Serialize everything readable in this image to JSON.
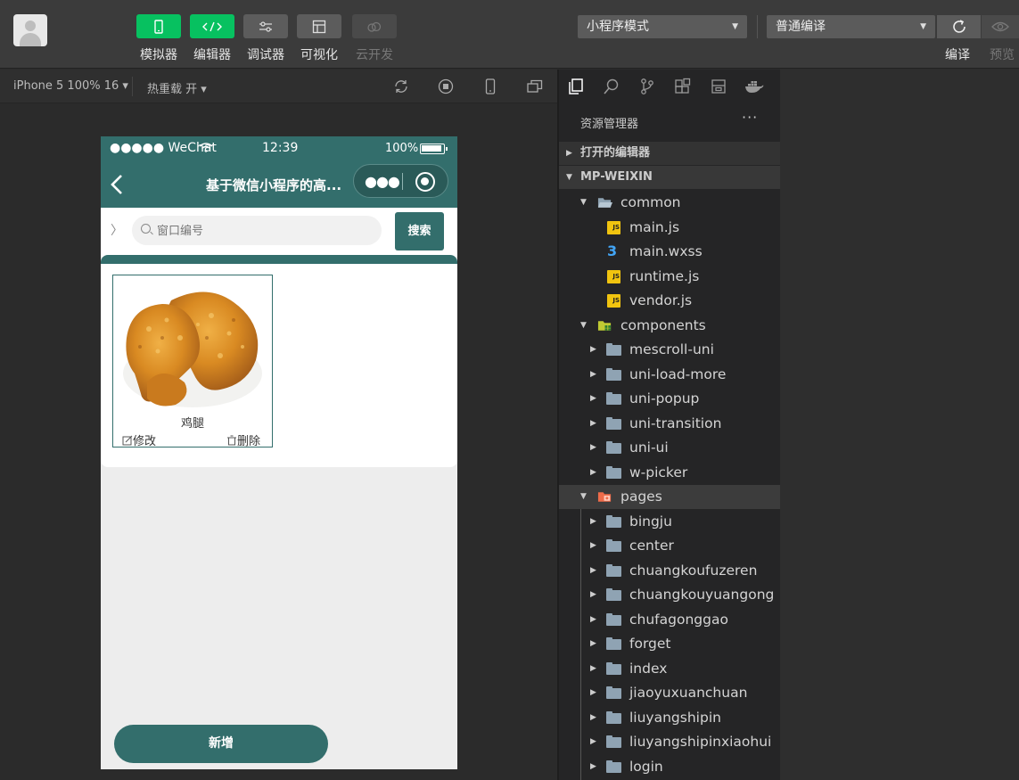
{
  "toolbar": {
    "tools": [
      {
        "label": "模拟器",
        "icon": "phone-icon",
        "style": "green"
      },
      {
        "label": "编辑器",
        "icon": "code-icon",
        "style": "green"
      },
      {
        "label": "调试器",
        "icon": "sliders-icon",
        "style": "gray"
      },
      {
        "label": "可视化",
        "icon": "layout-icon",
        "style": "gray"
      },
      {
        "label": "云开发",
        "icon": "cloud-icon",
        "style": "disabled"
      }
    ],
    "mode_select": "小程序模式",
    "compile_select": "普通编译",
    "compile_label": "编译",
    "preview_label": "预览"
  },
  "simulator_bar": {
    "device": "iPhone 5 100% 16",
    "hot_reload": "热重载 开"
  },
  "phone": {
    "status": {
      "carrier": "●●●●● WeChat",
      "time": "12:39",
      "battery": "100%"
    },
    "nav_title": "基于微信小程序的高...",
    "search": {
      "placeholder": "窗口编号",
      "button": "搜索"
    },
    "items": [
      {
        "name": "鸡腿",
        "edit": "修改",
        "delete": "删除"
      }
    ],
    "add_button": "新增"
  },
  "explorer": {
    "title": "资源管理器",
    "more": "···",
    "open_editors": "打开的编辑器",
    "root": "MP-WEIXIN",
    "common_folder": "common",
    "common_files": [
      {
        "name": "main.js",
        "type": "js"
      },
      {
        "name": "main.wxss",
        "type": "css"
      },
      {
        "name": "runtime.js",
        "type": "js"
      },
      {
        "name": "vendor.js",
        "type": "js"
      }
    ],
    "components_folder": "components",
    "components": [
      "mescroll-uni",
      "uni-load-more",
      "uni-popup",
      "uni-transition",
      "uni-ui",
      "w-picker"
    ],
    "pages_folder": "pages",
    "pages": [
      "bingju",
      "center",
      "chuangkoufuzeren",
      "chuangkouyuangong",
      "chufagonggao",
      "forget",
      "index",
      "jiaoyuxuanchuan",
      "liuyangshipin",
      "liuyangshipinxiaohui",
      "login"
    ]
  },
  "colors": {
    "theme": "#336e6c",
    "green": "#07c160"
  }
}
